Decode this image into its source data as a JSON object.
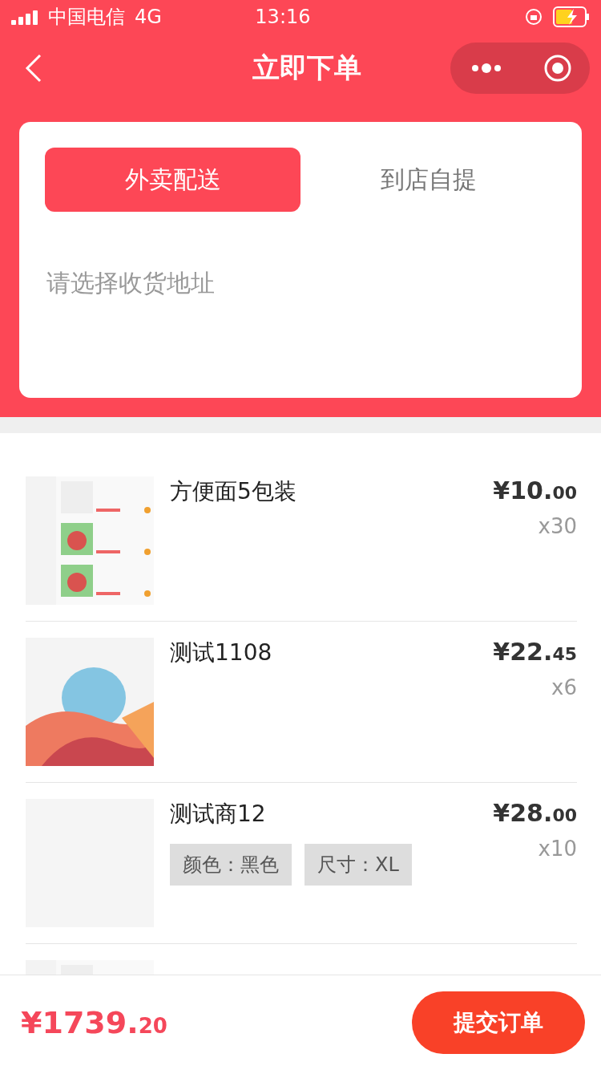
{
  "status_bar": {
    "carrier": "中国电信",
    "network": "4G",
    "time": "13:16"
  },
  "nav": {
    "title": "立即下单"
  },
  "delivery_tabs": [
    {
      "label": "外卖配送",
      "selected": true
    },
    {
      "label": "到店自提",
      "selected": false
    }
  ],
  "address": {
    "placeholder": "请选择收货地址"
  },
  "items": [
    {
      "name": "方便面5包装",
      "price_int": "¥10.",
      "price_dec": "00",
      "quantity": "x30",
      "thumb": {
        "kind": "picture"
      }
    },
    {
      "name": "测试1108",
      "price_int": "¥22.",
      "price_dec": "45",
      "quantity": "x6",
      "thumb": {
        "kind": "picture"
      }
    },
    {
      "name": "测试商12",
      "price_int": "¥28.",
      "price_dec": "00",
      "quantity": "x10",
      "thumb": {
        "kind": "blank"
      },
      "specs": [
        "颜色：黑色",
        "尺寸：XL"
      ]
    },
    {
      "thumb": {
        "kind": "picture"
      }
    }
  ],
  "footer": {
    "total_int": "¥1739.",
    "total_dec": "20",
    "submit": "提交订单"
  }
}
